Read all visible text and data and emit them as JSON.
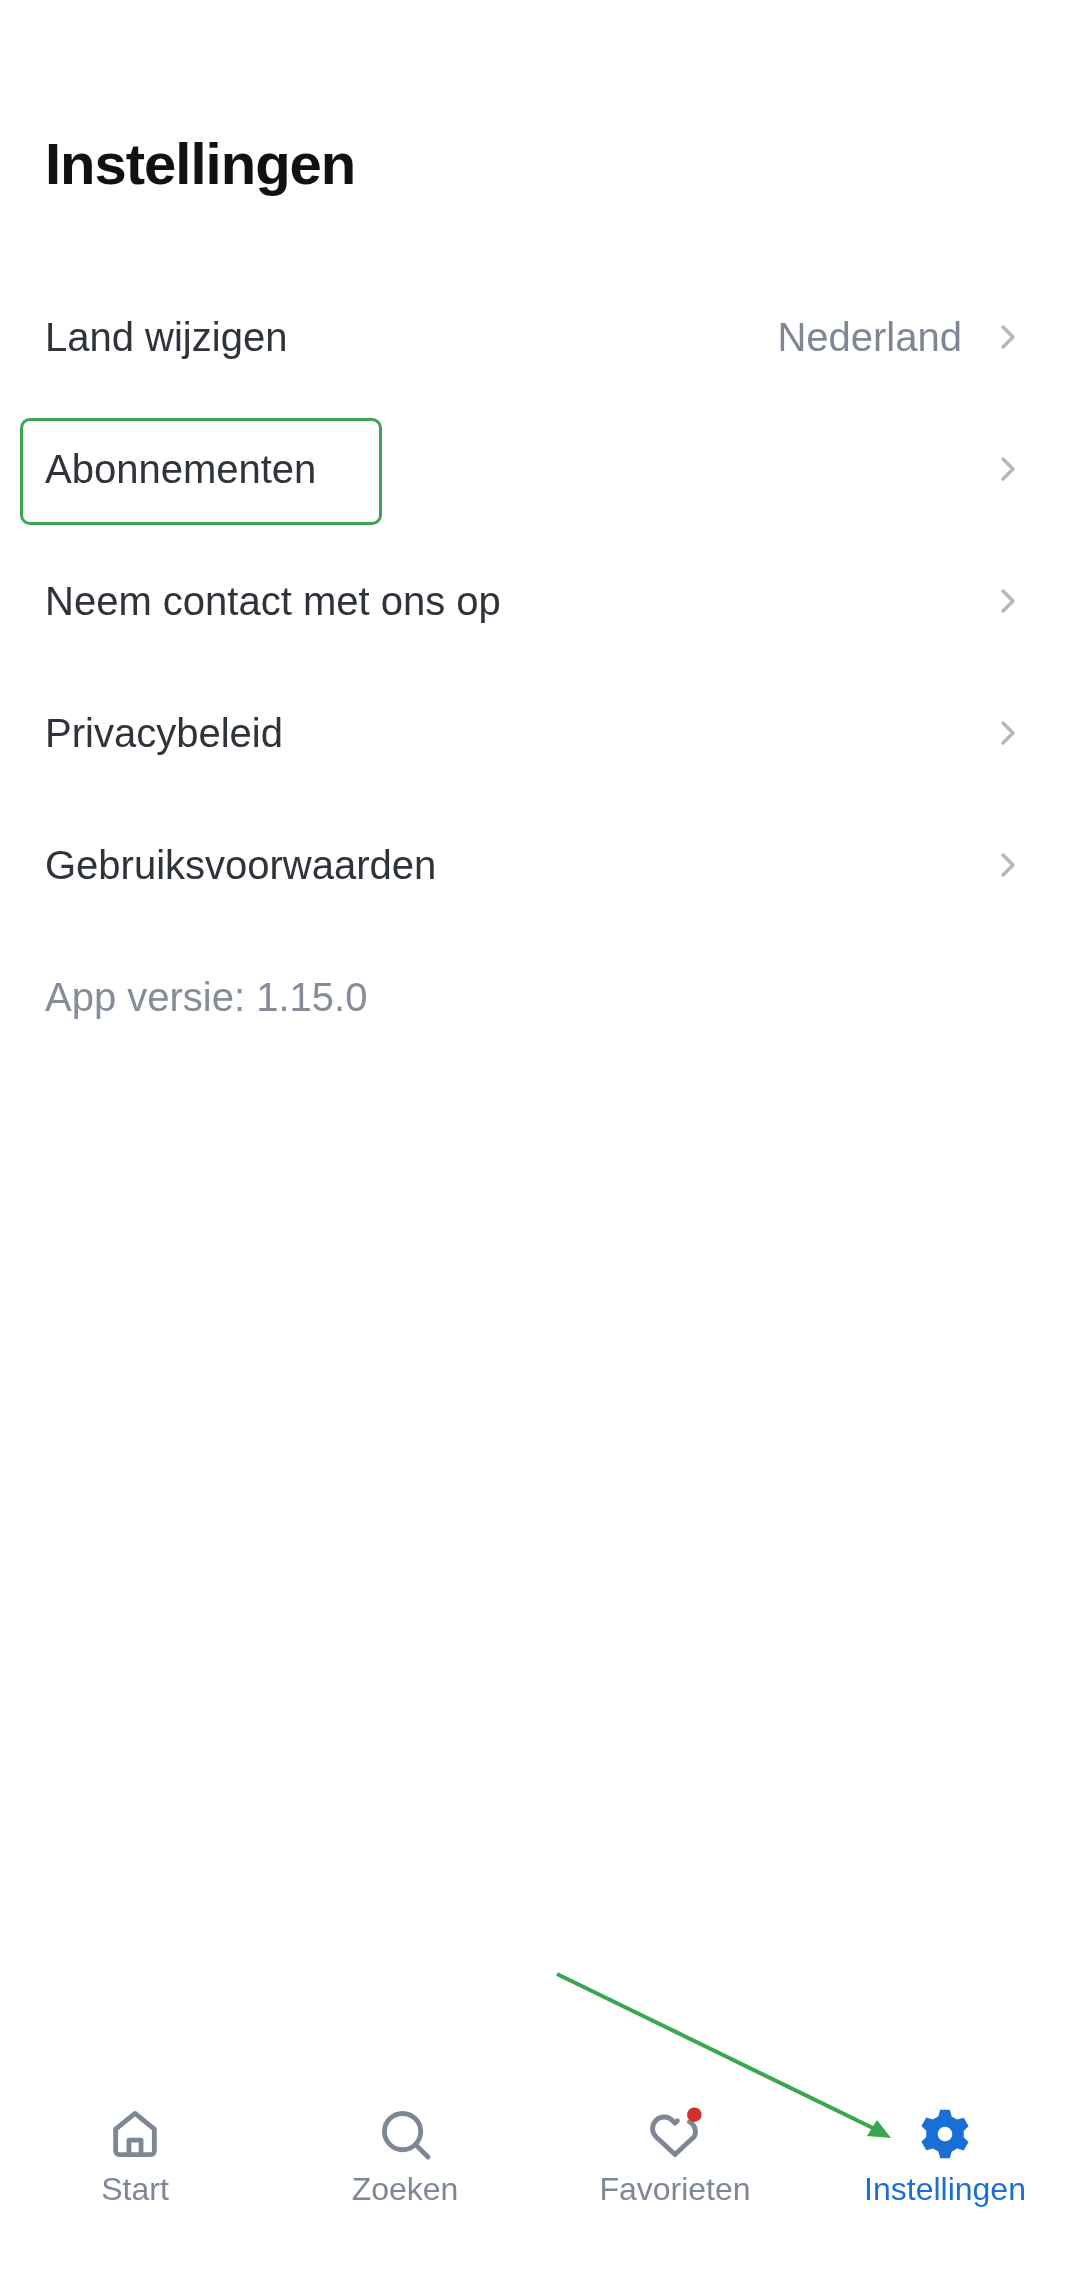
{
  "title": "Instellingen",
  "items": [
    {
      "label": "Land wijzigen",
      "value": "Nederland",
      "highlighted": false
    },
    {
      "label": "Abonnementen",
      "highlighted": true
    },
    {
      "label": "Neem contact met ons op",
      "highlighted": false
    },
    {
      "label": "Privacybeleid",
      "highlighted": false
    },
    {
      "label": "Gebruiksvoorwaarden",
      "highlighted": false
    }
  ],
  "version": "App versie: 1.15.0",
  "nav": [
    {
      "kind": "home",
      "label": "Start",
      "selected": false
    },
    {
      "kind": "search",
      "label": "Zoeken",
      "selected": false
    },
    {
      "kind": "favorites",
      "label": "Favorieten",
      "selected": false,
      "badge": true
    },
    {
      "kind": "settings",
      "label": "Instellingen",
      "selected": true
    }
  ]
}
